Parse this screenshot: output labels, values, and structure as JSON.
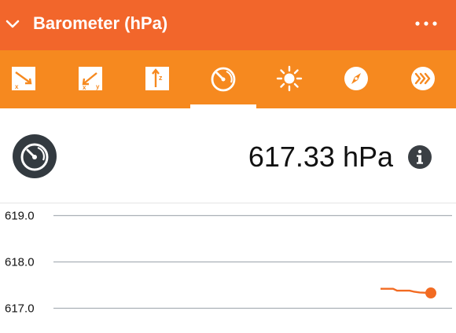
{
  "header": {
    "title": "Barometer (hPa)",
    "back_icon": "chevron-down-icon",
    "menu_icon": "more-dots-icon"
  },
  "colors": {
    "header_bg": "#f2662b",
    "toolbar_bg": "#f6891f",
    "accent": "#f26b22",
    "grid": "#aab0b6",
    "text": "#111111"
  },
  "toolbar": {
    "active_index": 3,
    "tools": [
      {
        "name": "linear-acceleration-x-icon"
      },
      {
        "name": "acceleration-xy-icon"
      },
      {
        "name": "acceleration-z-icon"
      },
      {
        "name": "barometer-gauge-icon"
      },
      {
        "name": "light-sun-icon"
      },
      {
        "name": "compass-icon"
      },
      {
        "name": "more-sensors-chevrons-icon"
      }
    ]
  },
  "reading": {
    "value": "617.33 hPa",
    "sensor_icon": "barometer-gauge-icon",
    "info_icon": "info-icon"
  },
  "chart_data": {
    "type": "line",
    "ylim": [
      616.8,
      619.2
    ],
    "ytick_labels": [
      "619.0",
      "618.0",
      "617.0"
    ],
    "yticks": [
      619.0,
      618.0,
      617.0
    ],
    "grid": true,
    "series": [
      {
        "values": [
          617.42,
          617.42,
          617.38,
          617.38,
          617.36,
          617.34,
          617.33
        ],
        "last_marker": true
      }
    ]
  }
}
